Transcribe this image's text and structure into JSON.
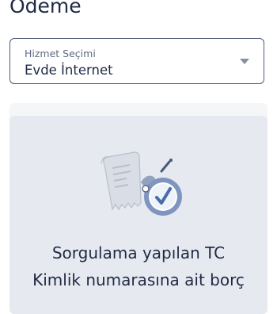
{
  "page": {
    "title": "Ödeme"
  },
  "service_select": {
    "label": "Hizmet Seçimi",
    "value": "Evde İnternet",
    "icon": "chevron-down-icon"
  },
  "notice": {
    "illustration": "receipt-checkmark-illustration",
    "line1": "Sorgulama yapılan TC",
    "line2": "Kimlik numarasına ait borç"
  },
  "colors": {
    "text": "#1f2a44",
    "border": "#4d5c78",
    "card_bg": "#e6e9ef",
    "icon_blue": "#4a6ba8"
  }
}
